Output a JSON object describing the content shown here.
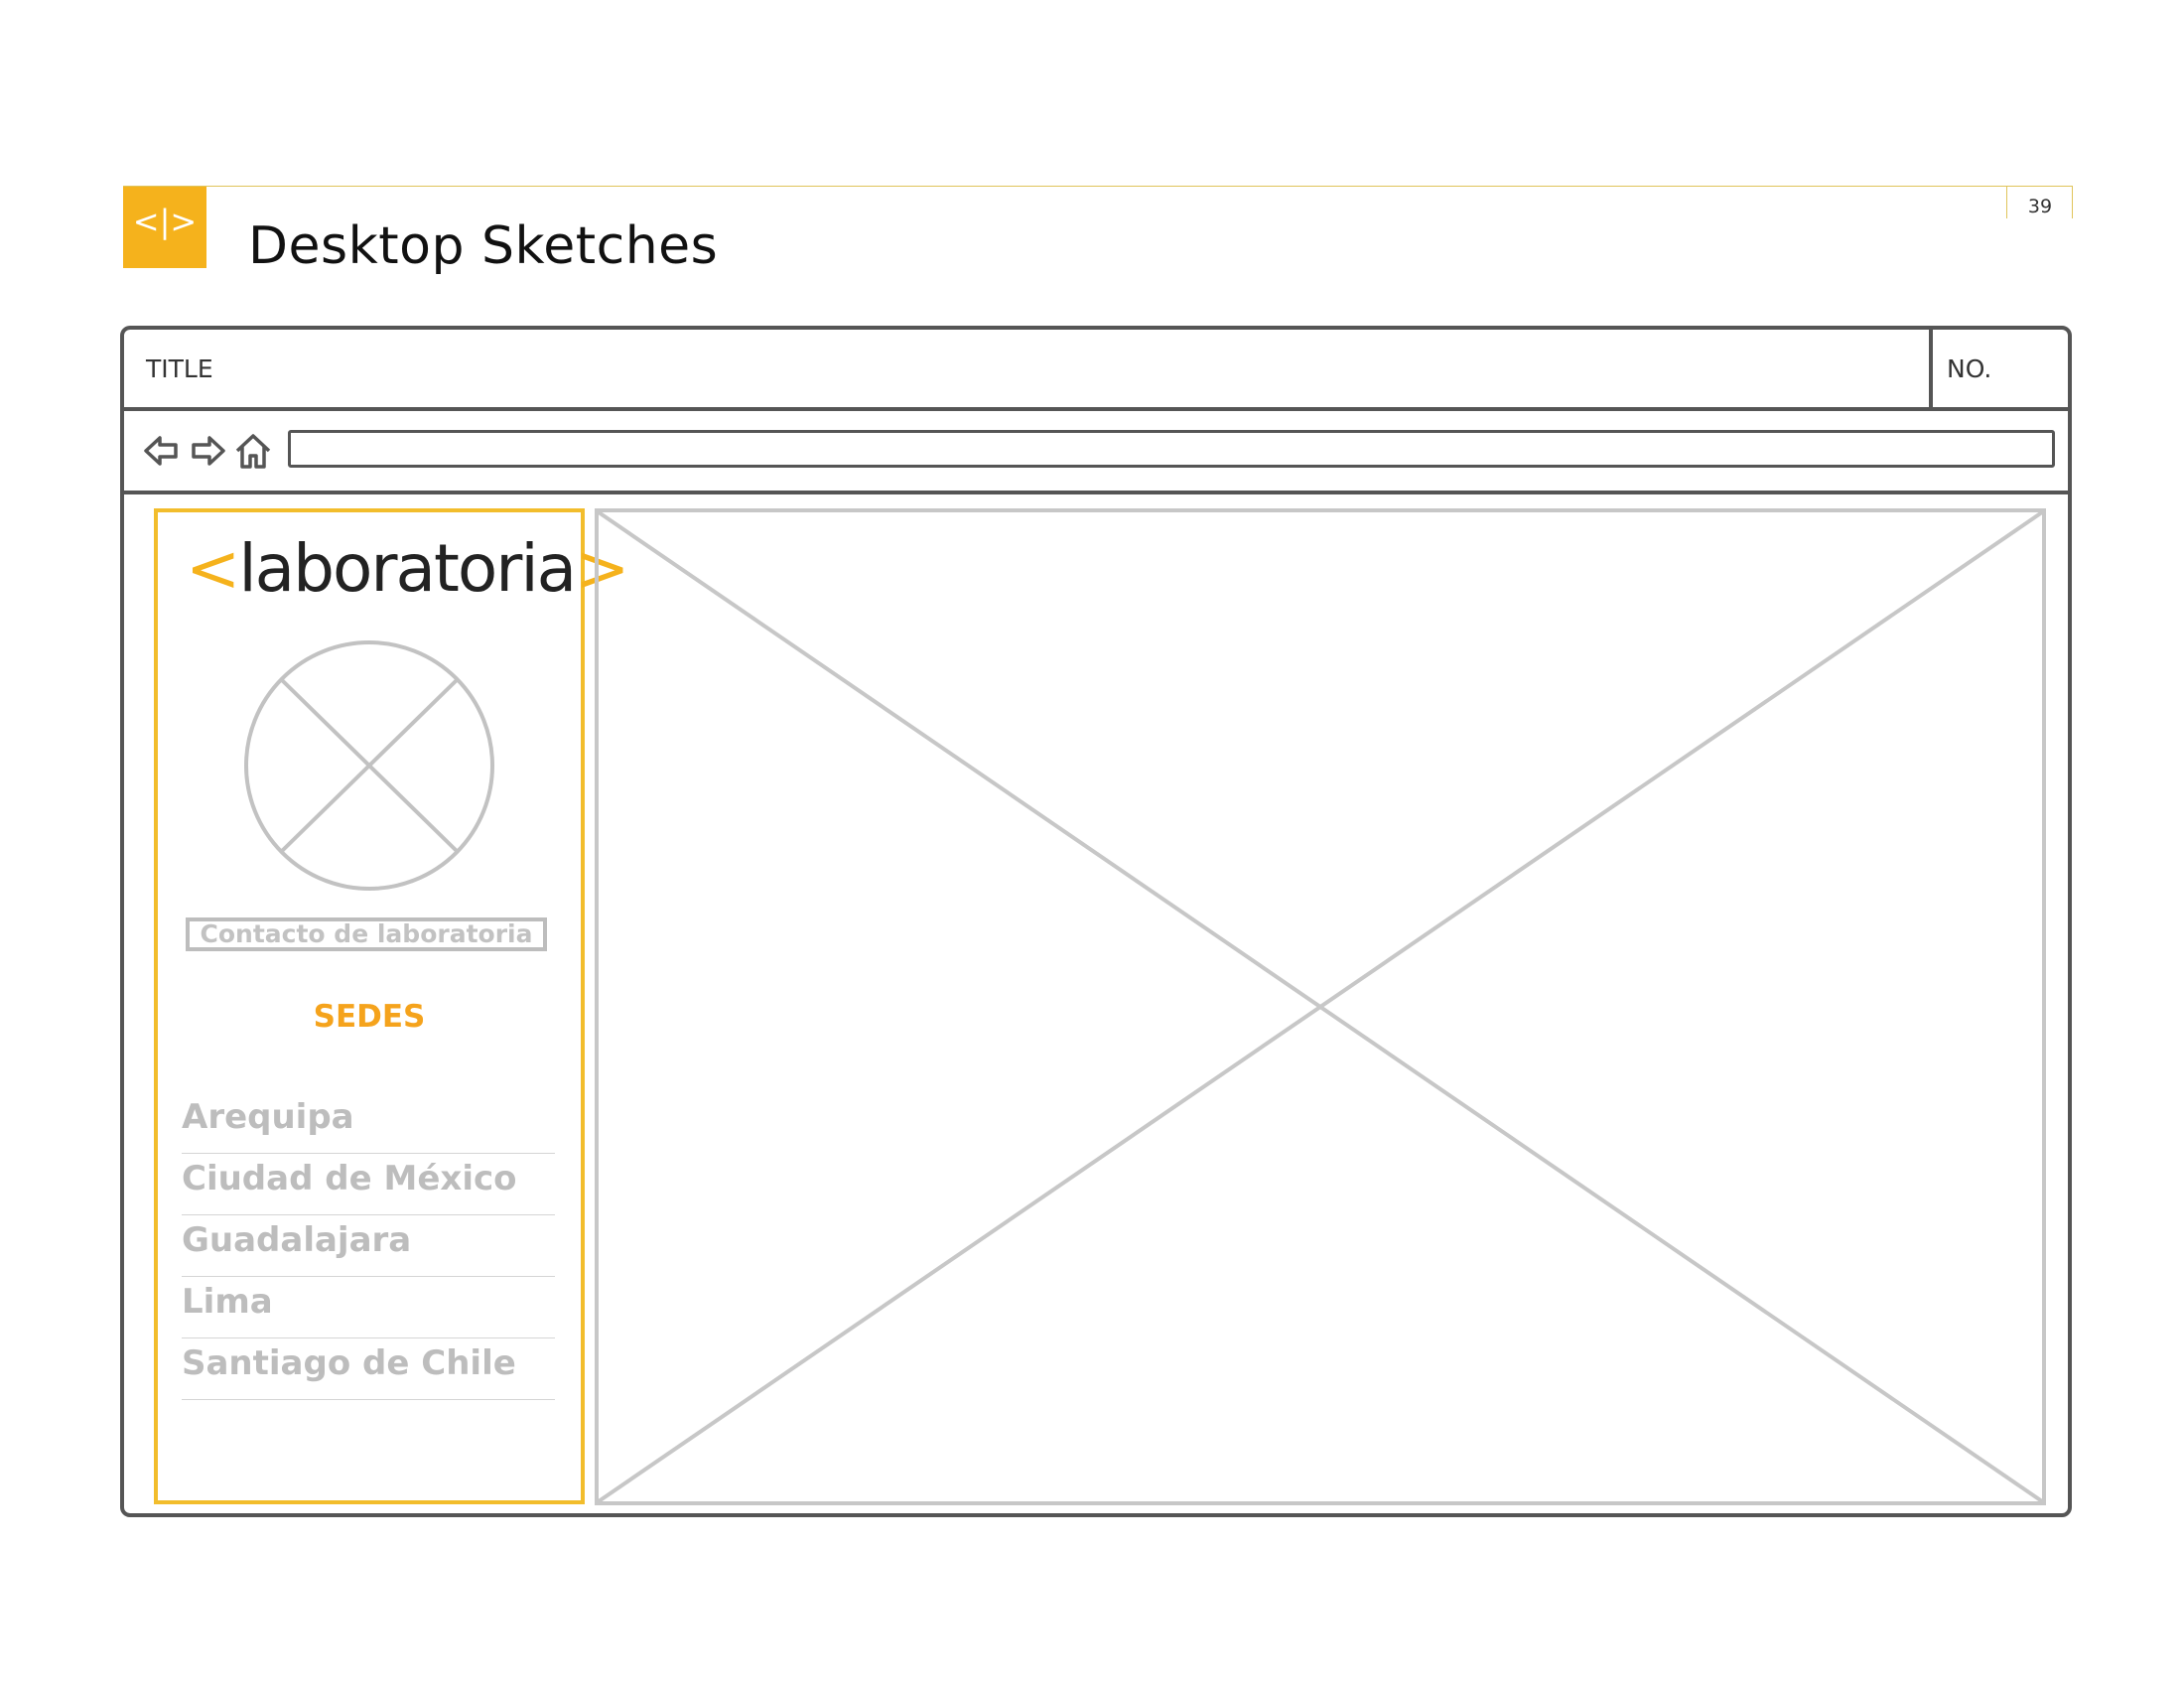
{
  "page": {
    "title": "Desktop Sketches",
    "number": "39",
    "logo_glyph": "<|>",
    "accent_color": "#f5b21c"
  },
  "browser": {
    "title_label": "TITLE",
    "no_label": "NO.",
    "nav": {
      "back_icon": "arrow-left-icon",
      "forward_icon": "arrow-right-icon",
      "home_icon": "home-icon"
    },
    "url_value": ""
  },
  "sidebar": {
    "brand_open": "<",
    "brand_name": "laboratoria",
    "brand_close": ">",
    "avatar_icon": "image-placeholder-icon",
    "contact_label": "Contacto de laboratoria",
    "sedes_heading": "SEDES",
    "cities": [
      "Arequipa",
      "Ciudad de México",
      "Guadalajara",
      "Lima",
      "Santiago de Chile"
    ]
  },
  "main": {
    "placeholder_icon": "image-placeholder-icon"
  }
}
